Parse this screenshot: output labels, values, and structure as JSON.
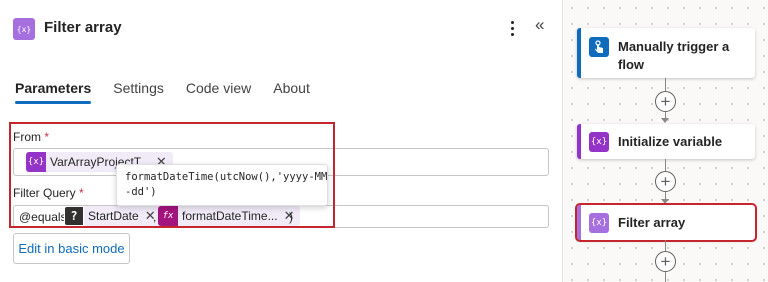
{
  "panel": {
    "title": "Filter array",
    "icon": "variable-icon",
    "icon_glyph": "{x}",
    "accent_color": "#a56fe0",
    "collapse_glyph": "«"
  },
  "tabs": [
    {
      "label": "Parameters",
      "active": true
    },
    {
      "label": "Settings",
      "active": false
    },
    {
      "label": "Code view",
      "active": false
    },
    {
      "label": "About",
      "active": false
    }
  ],
  "from": {
    "label": "From",
    "required_mark": "*",
    "token": {
      "icon_glyph": "{x}",
      "text": "VarArrayProjectT...",
      "remove": "✕",
      "color": "#9333c7"
    }
  },
  "filter_query": {
    "label": "Filter Query",
    "required_mark": "*",
    "prefix": "@equals(",
    "token1": {
      "icon_glyph": "?",
      "text": "StartDate",
      "remove": "✕",
      "color": "#323130"
    },
    "separator": ",",
    "token2": {
      "icon_glyph": "fx",
      "text": "formatDateTime...",
      "remove": "✕",
      "color": "#a4147e"
    },
    "suffix": ")"
  },
  "tooltip": {
    "line1": "formatDateTime(utcNow(),'yyyy-MM",
    "line2": "-dd')"
  },
  "edit_basic_button": "Edit in basic mode",
  "canvas": {
    "cards": [
      {
        "title": "Manually trigger a flow",
        "icon": "touch-trigger-icon",
        "color": "#0f6cbd",
        "selected": false
      },
      {
        "title": "Initialize variable",
        "icon": "variable-icon",
        "icon_glyph": "{x}",
        "color": "#9333c7",
        "selected": false
      },
      {
        "title": "Filter array",
        "icon": "variable-icon",
        "icon_glyph": "{x}",
        "color": "#a56fe0",
        "selected": true
      }
    ],
    "add_glyph": "+"
  },
  "colors": {
    "highlight": "#c4262e",
    "link_blue": "#0f6cbd"
  }
}
